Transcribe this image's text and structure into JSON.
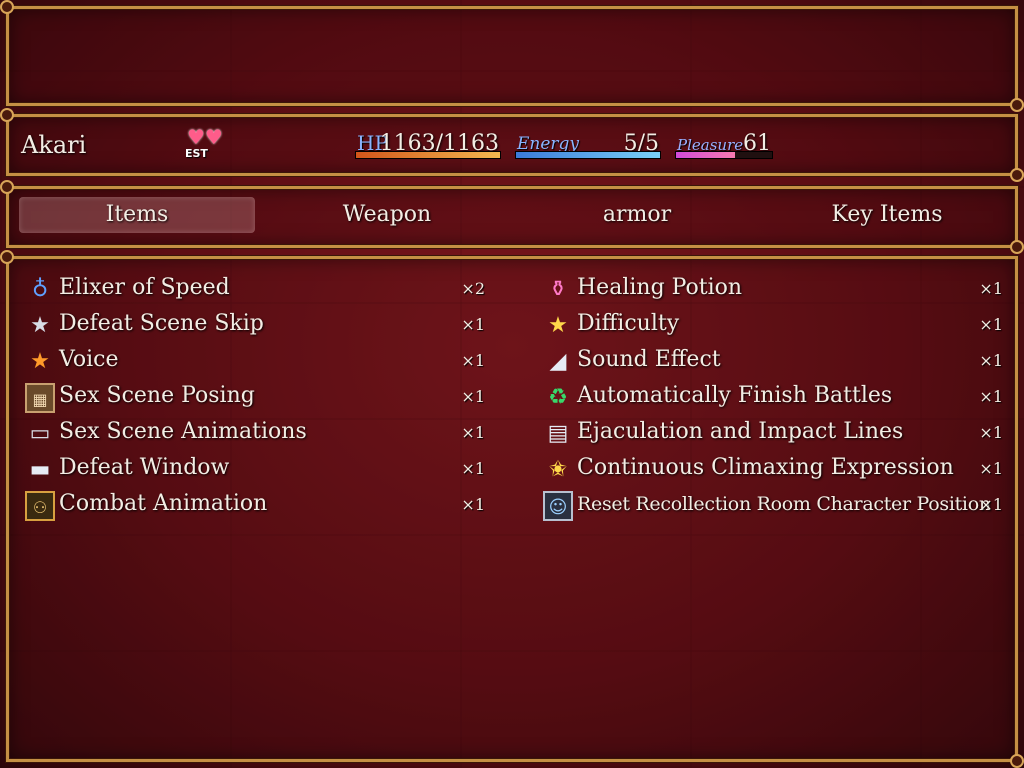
{
  "actor": {
    "name": "Akari",
    "state_icon": "hearts-est-icon",
    "state_tag": "EST",
    "hp": {
      "label": "HP",
      "value_text": "1163/1163",
      "current": 1163,
      "max": 1163
    },
    "energy": {
      "label": "Energy",
      "value_text": "5/5",
      "current": 5,
      "max": 5
    },
    "pleasure": {
      "label": "Pleasure",
      "value_text": "61",
      "fill_fraction": 0.61
    }
  },
  "tabs": [
    {
      "label": "Items",
      "selected": true
    },
    {
      "label": "Weapon",
      "selected": false
    },
    {
      "label": "armor",
      "selected": false
    },
    {
      "label": "Key Items",
      "selected": false
    }
  ],
  "items": [
    {
      "name": "Elixer of Speed",
      "qty": "×2",
      "icon": "potion-bottle-icon"
    },
    {
      "name": "Healing Potion",
      "qty": "×1",
      "icon": "pink-potion-icon"
    },
    {
      "name": "Defeat Scene Skip",
      "qty": "×1",
      "icon": "silver-star-icon"
    },
    {
      "name": "Difficulty",
      "qty": "×1",
      "icon": "gold-star-icon"
    },
    {
      "name": "Voice",
      "qty": "×1",
      "icon": "orange-star-icon"
    },
    {
      "name": "Sound Effect",
      "qty": "×1",
      "icon": "feather-icon"
    },
    {
      "name": "Sex Scene Posing",
      "qty": "×1",
      "icon": "picture-frame-icon"
    },
    {
      "name": "Automatically Finish Battles",
      "qty": "×1",
      "icon": "recycle-arrows-icon"
    },
    {
      "name": "Sex Scene Animations",
      "qty": "×1",
      "icon": "laptop-icon"
    },
    {
      "name": "Ejaculation and Impact Lines",
      "qty": "×1",
      "icon": "scroll-icon"
    },
    {
      "name": "Defeat Window",
      "qty": "×1",
      "icon": "window-bar-icon"
    },
    {
      "name": "Continuous Climaxing Expression",
      "qty": "×1",
      "icon": "sparkle-star-icon"
    },
    {
      "name": "Combat Animation",
      "qty": "×1",
      "icon": "people-icon"
    },
    {
      "name": "Reset Recollection Room Character Position",
      "qty": "×1",
      "icon": "character-portrait-icon"
    }
  ]
}
